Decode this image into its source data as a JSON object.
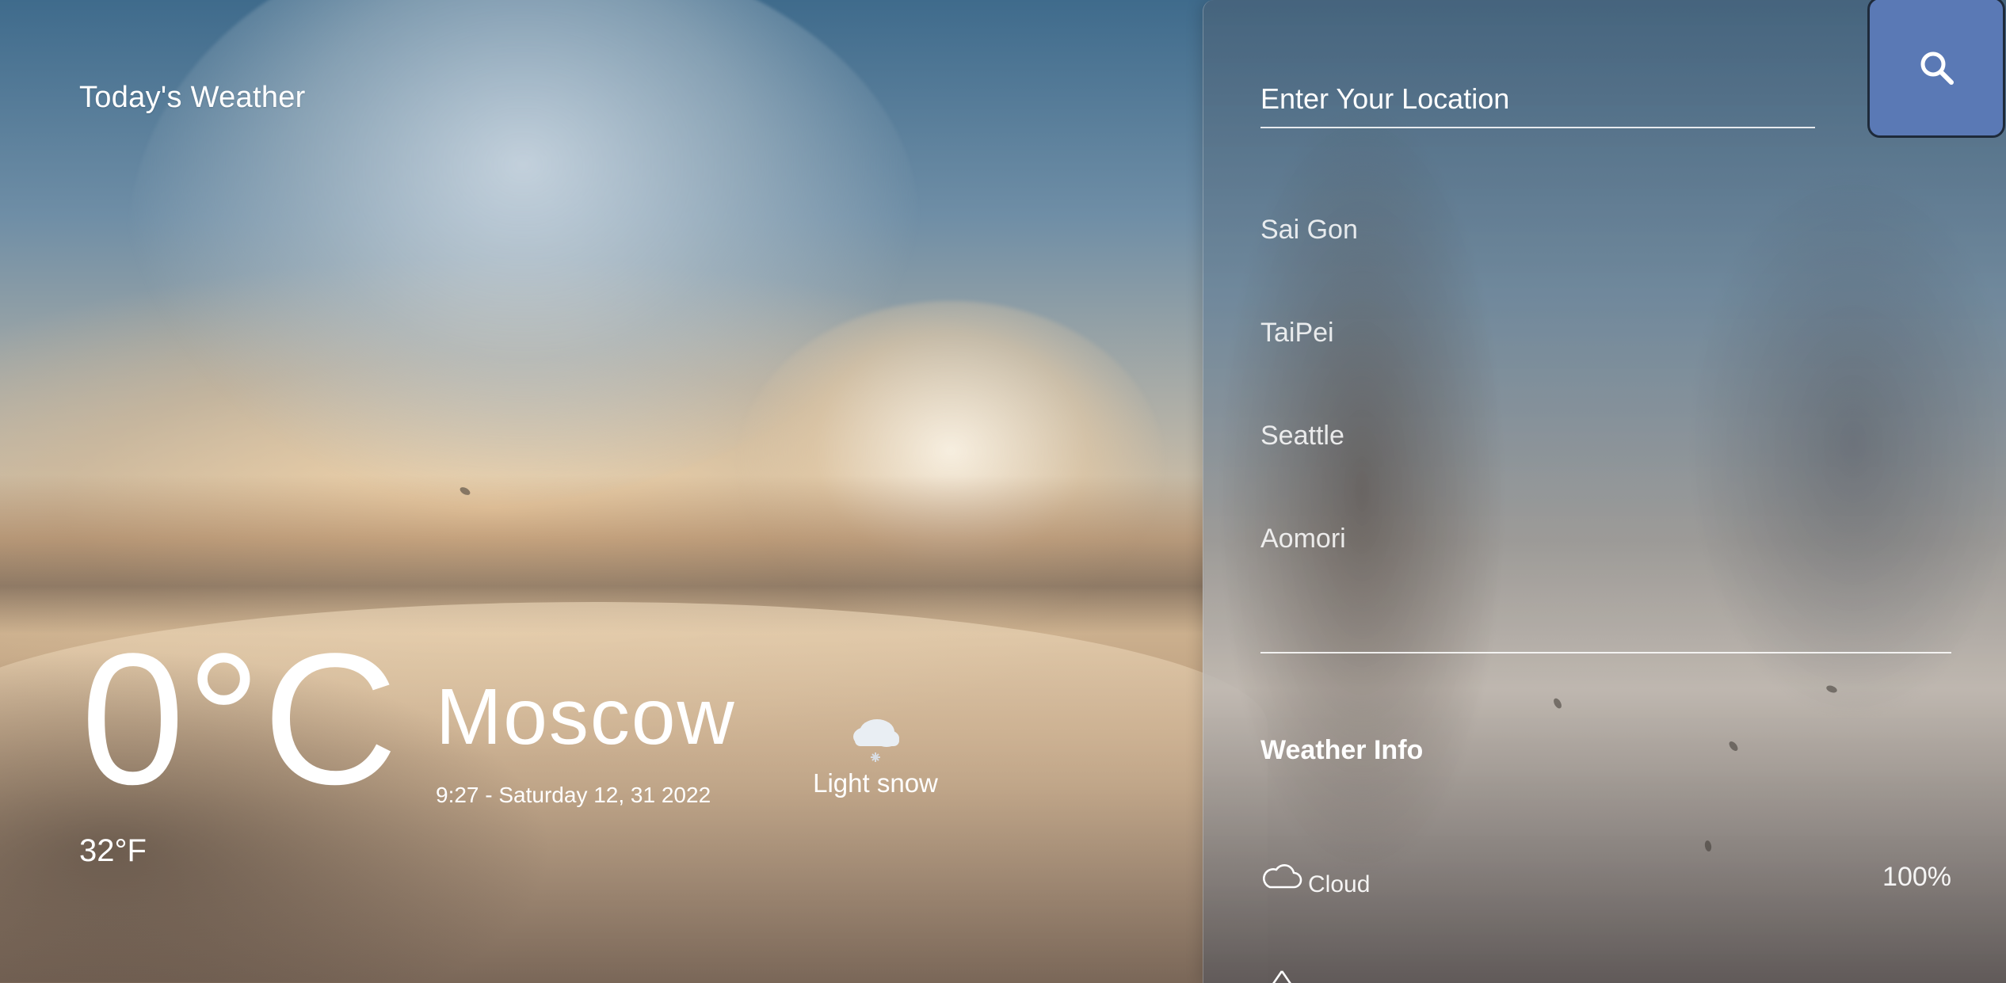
{
  "app": {
    "title": "Today's Weather"
  },
  "current": {
    "temp_c": "0°C",
    "temp_f": "32°F",
    "city": "Moscow",
    "datetime": "9:27 - Saturday 12, 31 2022",
    "condition": "Light snow",
    "condition_icon": "snow-cloud-icon"
  },
  "search": {
    "placeholder": "Enter Your Location",
    "button_icon": "search-icon"
  },
  "locations": [
    "Sai Gon",
    "TaiPei",
    "Seattle",
    "Aomori"
  ],
  "info": {
    "title": "Weather Info",
    "rows": [
      {
        "icon": "cloud-icon",
        "label": "Cloud",
        "value": "100%"
      }
    ]
  },
  "colors": {
    "search_button": "#5a79b5",
    "text": "#ffffff"
  }
}
